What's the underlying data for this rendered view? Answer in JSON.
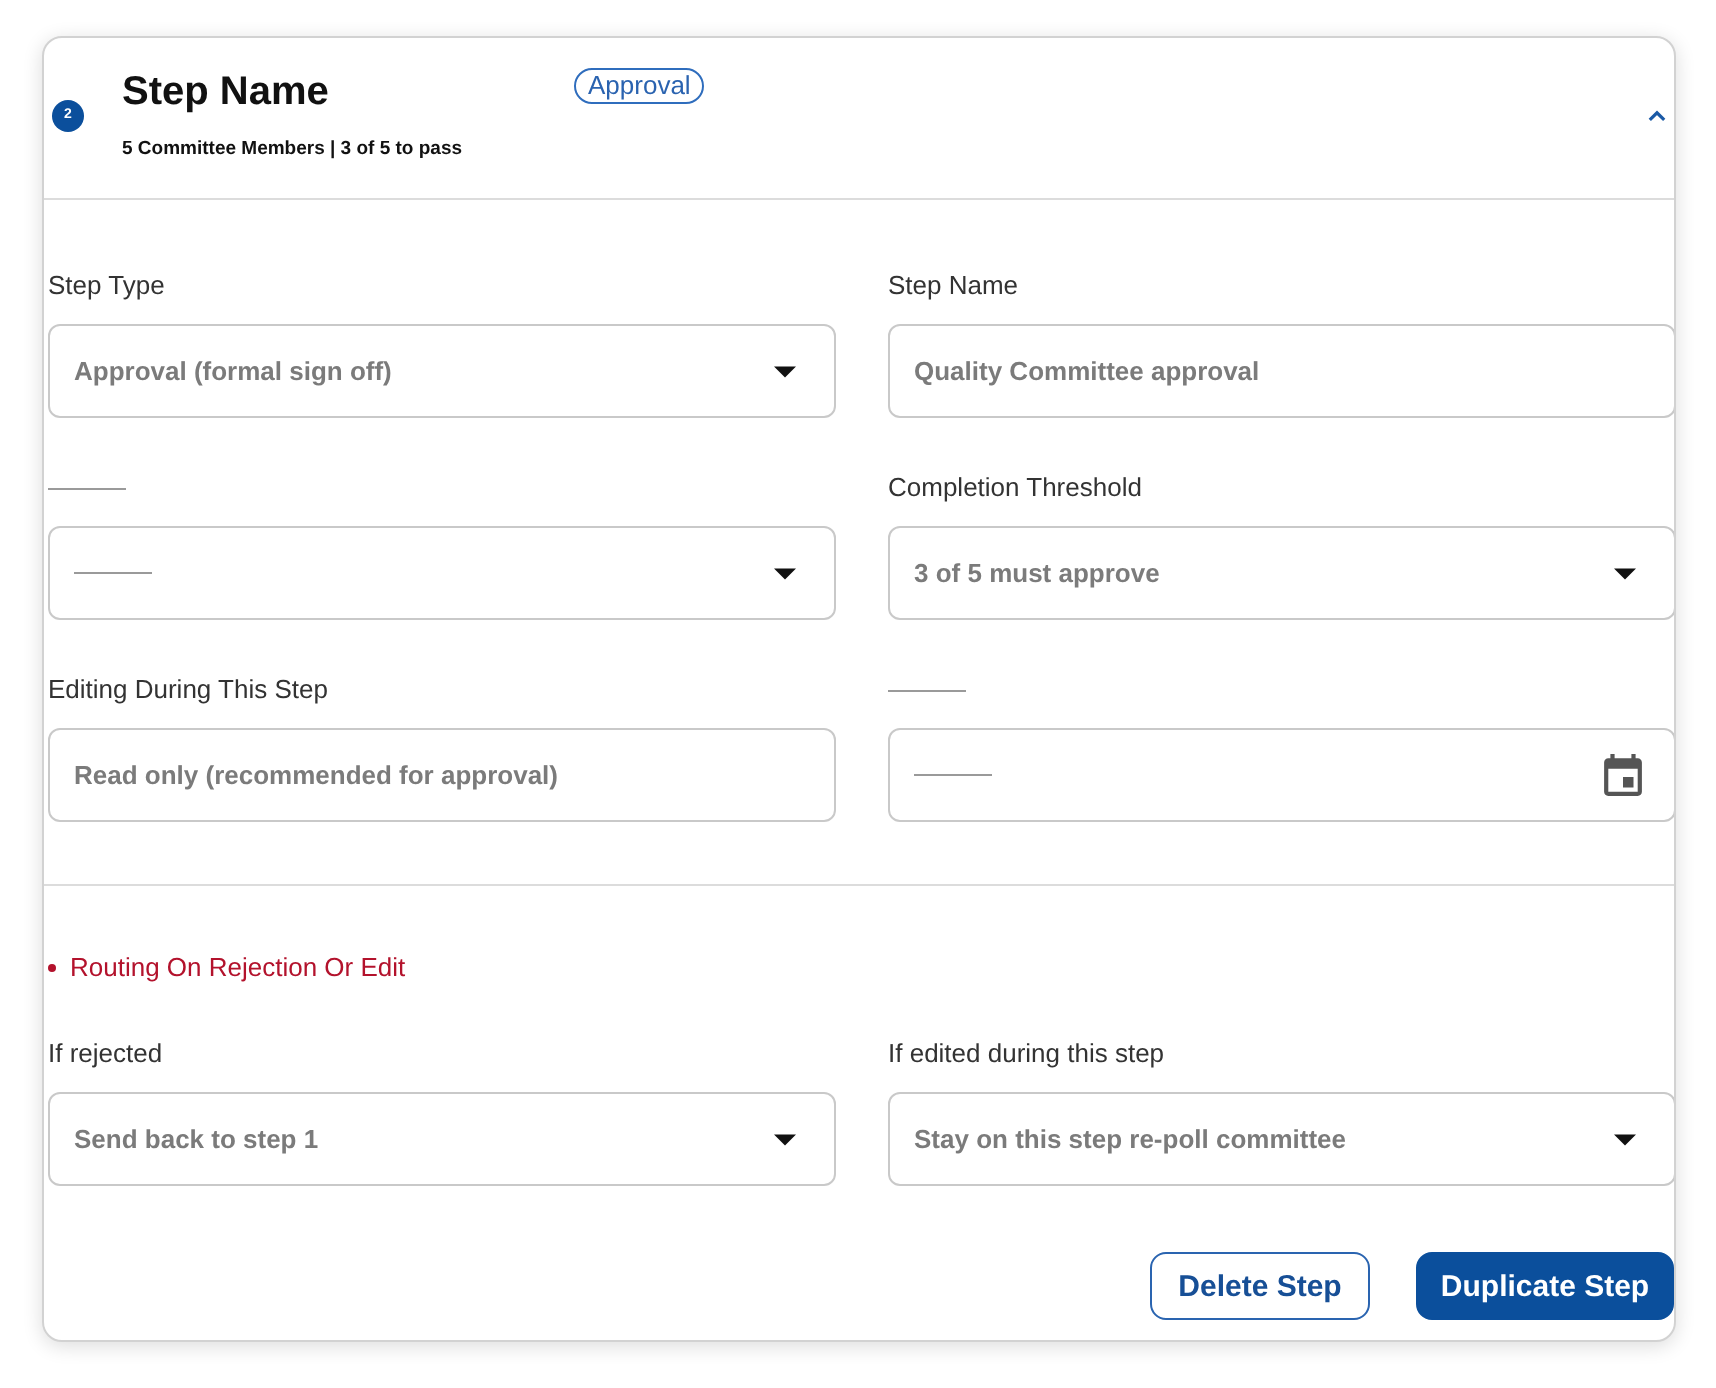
{
  "header": {
    "step_number": "2",
    "title": "Step Name",
    "subtitle": "5 Committee Members | 3 of 5 to pass",
    "tag": "Approval",
    "expanded": true
  },
  "fields": [
    {
      "kind": "select",
      "label": "Step Type",
      "value": "Approval (formal sign off)"
    },
    {
      "kind": "text",
      "label": "Step Name",
      "value": "Quality Committee approval"
    },
    {
      "kind": "select"
    },
    {
      "kind": "select",
      "label": "Completion Threshold",
      "value": "3 of 5 must approve"
    },
    {
      "kind": "text",
      "label": "Editing During This Step",
      "value": "Read only (recommended for approval)"
    },
    {
      "kind": "date"
    }
  ],
  "routing": {
    "title": "Routing On Rejection Or Edit",
    "fields": [
      {
        "kind": "select",
        "label": "If rejected",
        "value": "Send back to step 1"
      },
      {
        "kind": "select",
        "label": "If edited during this step",
        "value": "Stay on this step re-poll committee"
      }
    ]
  },
  "buttons": [
    {
      "label": "Delete Step",
      "kind": "secondary"
    },
    {
      "label": "Duplicate Step",
      "kind": "primary"
    }
  ]
}
